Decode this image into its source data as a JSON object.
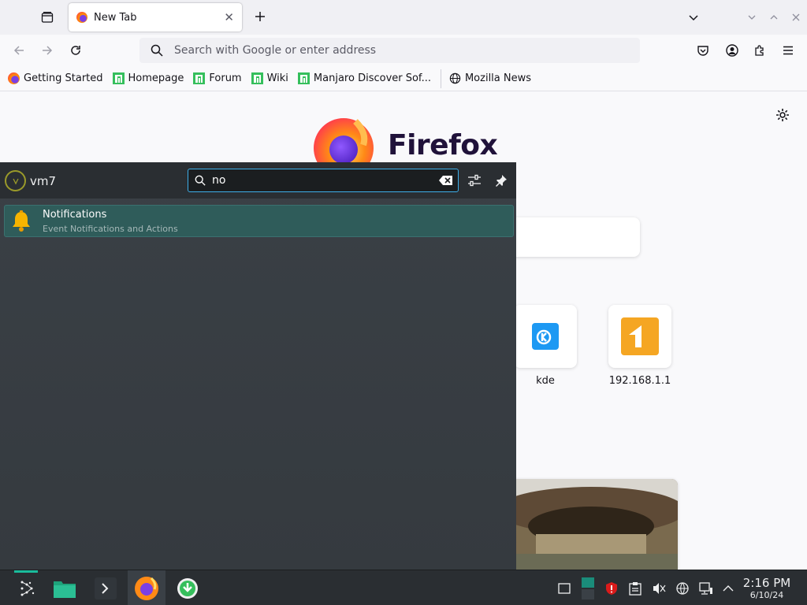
{
  "browser": {
    "tab": {
      "title": "New Tab"
    },
    "urlbar": {
      "placeholder": "Search with Google or enter address"
    },
    "bookmarks": [
      {
        "label": "Getting Started",
        "icon": "firefox-icon"
      },
      {
        "label": "Homepage",
        "icon": "manjaro-icon"
      },
      {
        "label": "Forum",
        "icon": "manjaro-icon"
      },
      {
        "label": "Wiki",
        "icon": "manjaro-icon"
      },
      {
        "label": "Manjaro Discover Sof...",
        "icon": "manjaro-icon"
      },
      {
        "label": "Mozilla News",
        "icon": "globe-icon"
      }
    ]
  },
  "newtab": {
    "wordmark": "Firefox",
    "shortcuts": [
      {
        "label": "kde",
        "icon": "kde-icon"
      },
      {
        "label": "192.168.1.1",
        "icon": "router-icon"
      }
    ]
  },
  "launcher": {
    "user_name": "vm7",
    "query": "no",
    "results": [
      {
        "title": "Notifications",
        "subtitle": "Event Notifications and Actions",
        "icon": "bell-icon"
      }
    ]
  },
  "taskbar": {
    "clock_time": "2:16 PM",
    "clock_date": "6/10/24"
  },
  "colors": {
    "accent": "#3daee9",
    "launcher_bg": "#3a4046",
    "selection": "#2f5c5a",
    "manjaro_green": "#35bf5c"
  }
}
